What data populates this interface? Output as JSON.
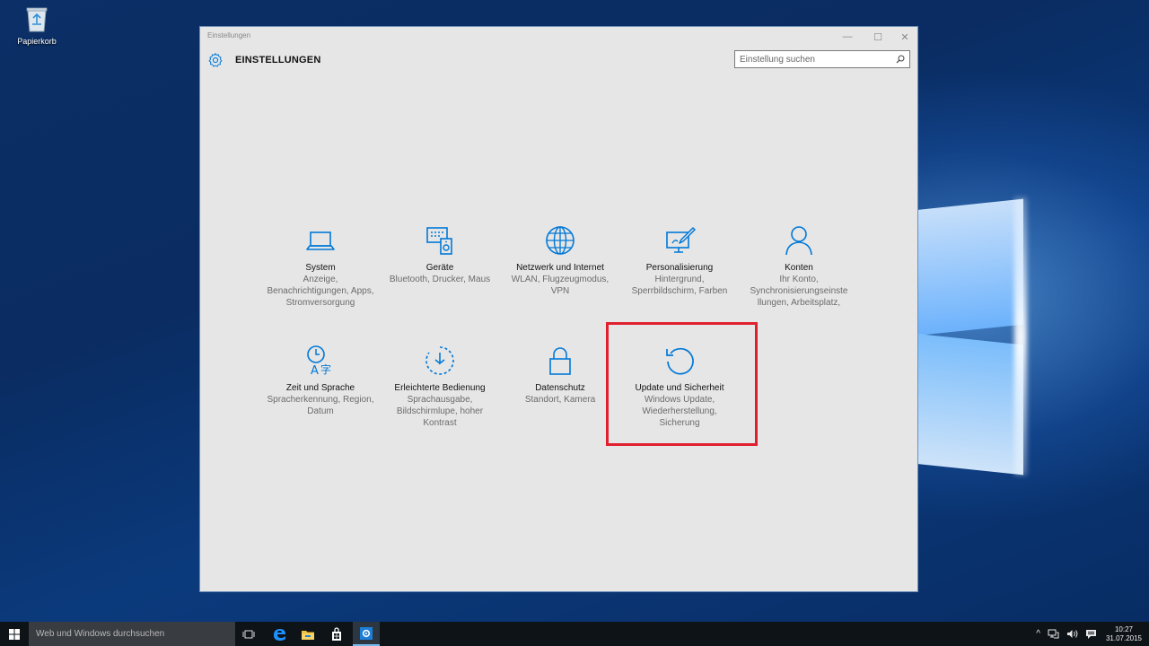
{
  "desktop": {
    "recycle_bin_label": "Papierkorb"
  },
  "window": {
    "title": "Einstellungen",
    "controls": {
      "minimize": "—",
      "maximize": "☐",
      "close": "✕"
    },
    "app_title": "EINSTELLUNGEN",
    "search_placeholder": "Einstellung suchen",
    "accent_color": "#0078d7"
  },
  "tiles": [
    {
      "name": "System",
      "desc": "Anzeige, Benachrichtigungen, Apps, Stromversorgung",
      "icon": "laptop-icon"
    },
    {
      "name": "Geräte",
      "desc": "Bluetooth, Drucker, Maus",
      "icon": "devices-icon"
    },
    {
      "name": "Netzwerk und Internet",
      "desc": "WLAN, Flugzeugmodus, VPN",
      "icon": "globe-icon"
    },
    {
      "name": "Personalisierung",
      "desc": "Hintergrund, Sperrbildschirm, Farben",
      "icon": "personalization-icon"
    },
    {
      "name": "Konten",
      "desc": "Ihr Konto, Synchronisierungseinste llungen, Arbeitsplatz,",
      "icon": "person-icon"
    },
    {
      "name": "Zeit und Sprache",
      "desc": "Spracherkennung, Region, Datum",
      "icon": "time-language-icon"
    },
    {
      "name": "Erleichterte Bedienung",
      "desc": "Sprachausgabe, Bildschirmlupe, hoher Kontrast",
      "icon": "ease-of-access-icon"
    },
    {
      "name": "Datenschutz",
      "desc": "Standort, Kamera",
      "icon": "lock-icon"
    },
    {
      "name": "Update und Sicherheit",
      "desc": "Windows Update, Wiederherstellung, Sicherung",
      "icon": "update-icon"
    }
  ],
  "highlight_color": "#e0202e",
  "taskbar": {
    "search_text": "Web und Windows durchsuchen",
    "clock_time": "10:27",
    "clock_date": "31.07.2015",
    "tray_chevron": "^"
  }
}
